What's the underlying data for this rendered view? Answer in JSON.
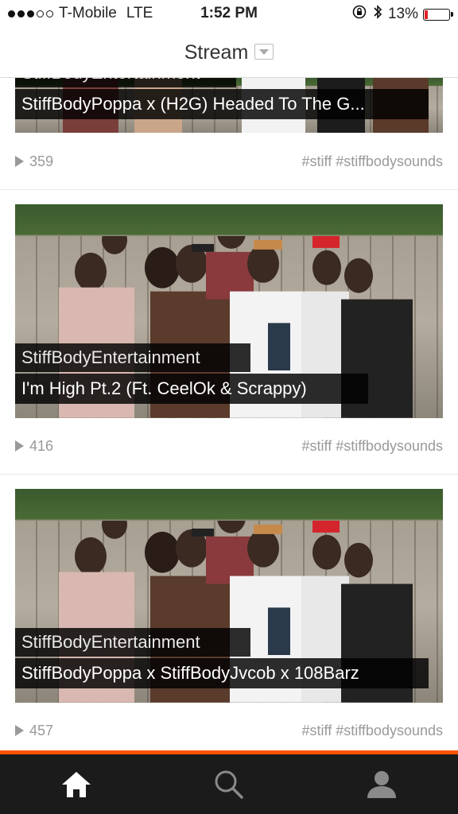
{
  "status_bar": {
    "carrier": "T-Mobile",
    "network": "LTE",
    "time": "1:52 PM",
    "battery_text": "13%",
    "battery_level": 0.13,
    "signal_bars_filled": 3,
    "signal_bars_total": 5
  },
  "nav": {
    "title": "Stream"
  },
  "tracks": [
    {
      "username": "StiffBodyEntertainment",
      "title": "StiffBodyPoppa x (H2G) Headed To The G...",
      "plays": "359",
      "tags": "#stiff #stiffbodysounds"
    },
    {
      "username": "StiffBodyEntertainment",
      "title": "I'm High Pt.2 (Ft. CeelOk & Scrappy)",
      "plays": "416",
      "tags": "#stiff #stiffbodysounds"
    },
    {
      "username": "StiffBodyEntertainment",
      "title": "StiffBodyPoppa x StiffBodyJvcob x 108Barz",
      "plays": "457",
      "tags": "#stiff #stiffbodysounds"
    }
  ],
  "tabs": [
    {
      "name": "home",
      "icon": "home-icon"
    },
    {
      "name": "search",
      "icon": "search-icon"
    },
    {
      "name": "profile",
      "icon": "user-icon"
    }
  ],
  "colors": {
    "accent": "#ff5500",
    "tab_bar": "#1b1b1b",
    "battery_low": "#e0242b",
    "meta_text": "#999999"
  }
}
